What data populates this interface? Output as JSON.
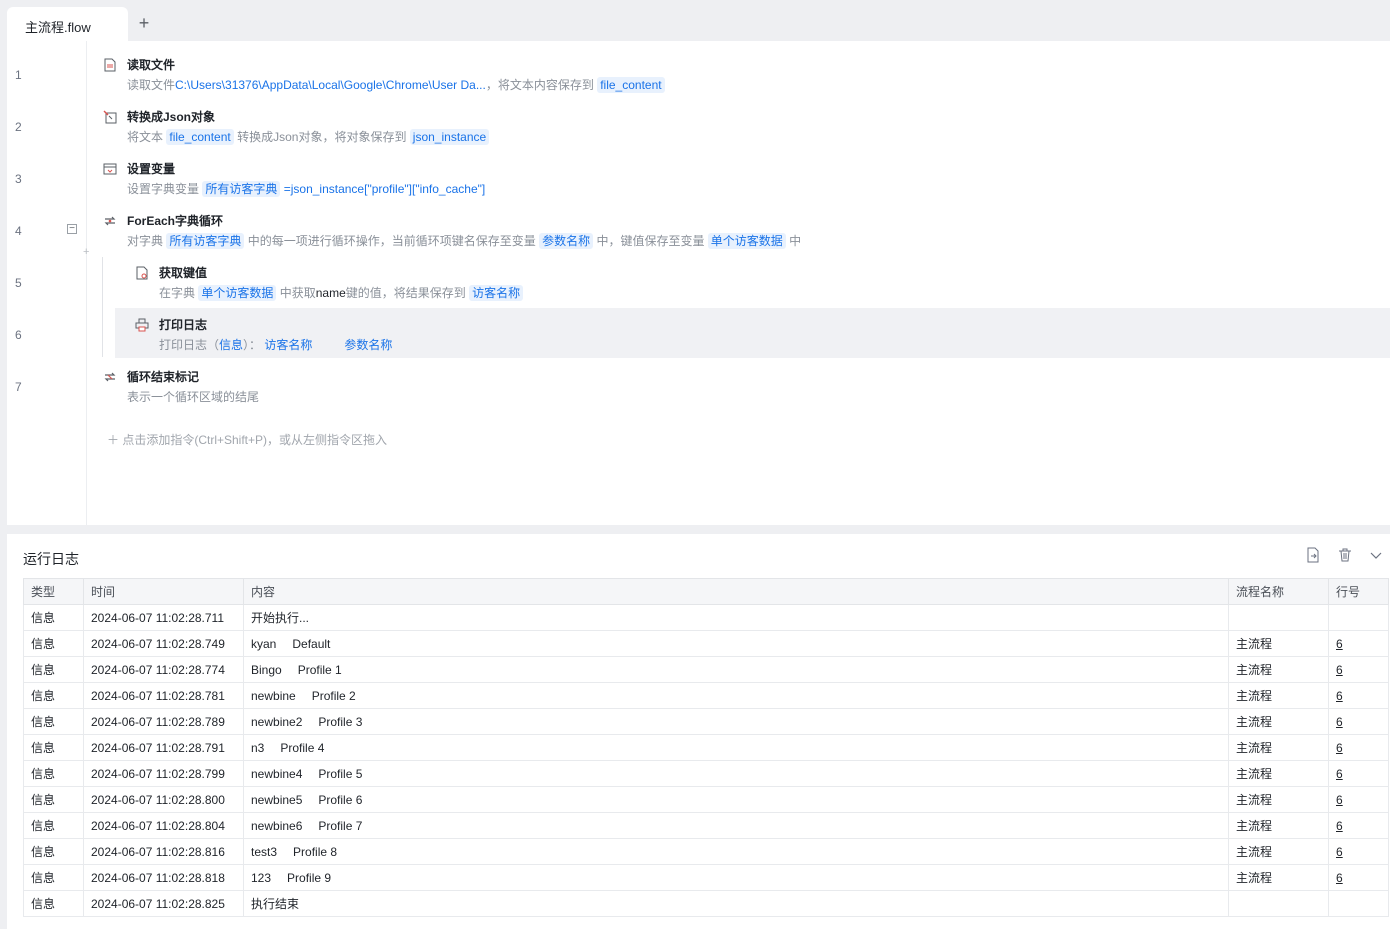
{
  "tab": {
    "title": "主流程.flow",
    "add_label": "+"
  },
  "editor": {
    "line_numbers": [
      "1",
      "2",
      "3",
      "4",
      "5",
      "6",
      "7"
    ],
    "steps": [
      {
        "title": "读取文件",
        "desc_prefix": "读取文件",
        "path": "C:\\Users\\31376\\AppData\\Local\\Google\\Chrome\\User Da...",
        "desc_mid": "，将文本内容保存到",
        "var": "file_content",
        "icon": "read-file-icon"
      },
      {
        "title": "转换成Json对象",
        "desc_prefix": "将文本",
        "var1": "file_content",
        "desc_mid": "转换成Json对象，将对象保存到",
        "var2": "json_instance",
        "icon": "json-convert-icon"
      },
      {
        "title": "设置变量",
        "desc_prefix": "设置字典变量",
        "var": "所有访客字典",
        "expr": "=json_instance[\"profile\"][\"info_cache\"]",
        "icon": "set-variable-icon"
      },
      {
        "title": "ForEach字典循环",
        "desc_prefix": "对字典",
        "var1": "所有访客字典",
        "desc_mid1": "中的每一项进行循环操作，当前循环项键名保存至变量",
        "var2": "参数名称",
        "desc_mid2": "中，键值保存至变量",
        "var3": "单个访客数据",
        "desc_suffix": "中",
        "icon": "loop-icon"
      },
      {
        "title": "获取键值",
        "desc_prefix": "在字典",
        "var1": "单个访客数据",
        "desc_mid": "中获取",
        "key": "name",
        "desc_mid2": "键的值，将结果保存到",
        "var2": "访客名称",
        "icon": "get-key-icon"
      },
      {
        "title": "打印日志",
        "desc_prefix": "打印日志（",
        "level": "信息",
        "desc_mid": "）：",
        "var1": "访客名称",
        "var2": "参数名称",
        "icon": "print-icon"
      },
      {
        "title": "循环结束标记",
        "desc": "表示一个循环区域的结尾",
        "icon": "loop-end-icon"
      }
    ],
    "add_hint": "＋  点击添加指令(Ctrl+Shift+P)，或从左侧指令区拖入"
  },
  "log": {
    "title": "运行日志",
    "columns": [
      "类型",
      "时间",
      "内容",
      "流程名称",
      "行号"
    ],
    "rows": [
      {
        "type": "信息",
        "time": "2024-06-07 11:02:28.711",
        "c1": "开始执行...",
        "c2": "",
        "flow": "",
        "line": ""
      },
      {
        "type": "信息",
        "time": "2024-06-07 11:02:28.749",
        "c1": "kyan",
        "c2": "Default",
        "flow": "主流程",
        "line": "6"
      },
      {
        "type": "信息",
        "time": "2024-06-07 11:02:28.774",
        "c1": "Bingo",
        "c2": "Profile 1",
        "flow": "主流程",
        "line": "6"
      },
      {
        "type": "信息",
        "time": "2024-06-07 11:02:28.781",
        "c1": "newbine",
        "c2": "Profile 2",
        "flow": "主流程",
        "line": "6"
      },
      {
        "type": "信息",
        "time": "2024-06-07 11:02:28.789",
        "c1": "newbine2",
        "c2": "Profile 3",
        "flow": "主流程",
        "line": "6"
      },
      {
        "type": "信息",
        "time": "2024-06-07 11:02:28.791",
        "c1": "n3",
        "c2": "Profile 4",
        "flow": "主流程",
        "line": "6"
      },
      {
        "type": "信息",
        "time": "2024-06-07 11:02:28.799",
        "c1": "newbine4",
        "c2": "Profile 5",
        "flow": "主流程",
        "line": "6"
      },
      {
        "type": "信息",
        "time": "2024-06-07 11:02:28.800",
        "c1": "newbine5",
        "c2": "Profile 6",
        "flow": "主流程",
        "line": "6"
      },
      {
        "type": "信息",
        "time": "2024-06-07 11:02:28.804",
        "c1": "newbine6",
        "c2": "Profile 7",
        "flow": "主流程",
        "line": "6"
      },
      {
        "type": "信息",
        "time": "2024-06-07 11:02:28.816",
        "c1": "test3",
        "c2": "Profile 8",
        "flow": "主流程",
        "line": "6"
      },
      {
        "type": "信息",
        "time": "2024-06-07 11:02:28.818",
        "c1": "123",
        "c2": "Profile 9",
        "flow": "主流程",
        "line": "6"
      },
      {
        "type": "信息",
        "time": "2024-06-07 11:02:28.825",
        "c1": "执行结束",
        "c2": "",
        "flow": "",
        "line": ""
      }
    ]
  },
  "colors": {
    "accent": "#1a73e8",
    "var_bg": "#e8f1fd",
    "icon_red": "#d9534f"
  }
}
